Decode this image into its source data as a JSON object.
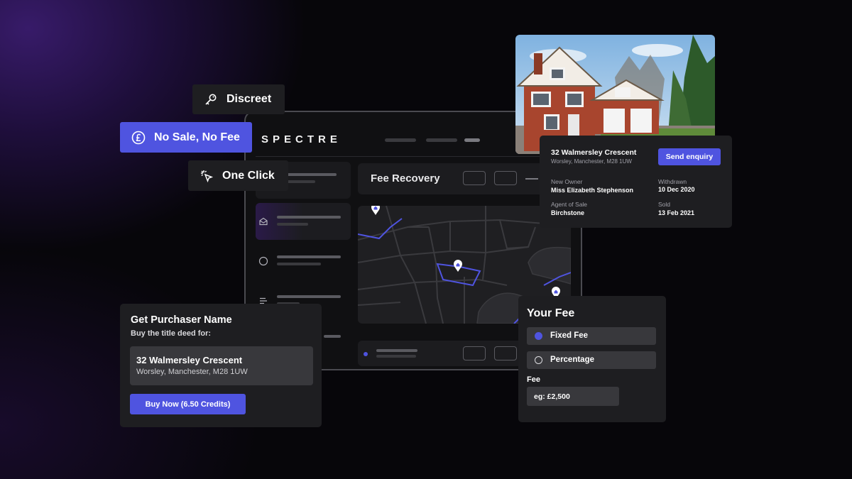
{
  "colors": {
    "accent": "#4f54e0",
    "card_bg": "#1e1e21",
    "field_bg": "#38383c",
    "background": "#07060a",
    "purple_glow": "#3a1c6e"
  },
  "pills": {
    "discreet": {
      "label": "Discreet",
      "icon": "key-icon"
    },
    "no_sale": {
      "label": "No Sale, No Fee",
      "icon": "pound-icon"
    },
    "one_click": {
      "label": "One Click",
      "icon": "cursor-click-icon"
    }
  },
  "app": {
    "logo": "SPECTRE",
    "section_title": "Fee Recovery",
    "sidebar_icons": [
      "mail-icon",
      "circle-icon",
      "list-icon"
    ],
    "map_pins": [
      "home-pin-icon",
      "home-pin-icon",
      "home-pin-icon"
    ]
  },
  "property": {
    "address": "32 Walmersley Crescent",
    "location": "Worsley, Manchester, M28 1UW",
    "send_enquiry_label": "Send enquiry",
    "new_owner_label": "New Owner",
    "new_owner_value": "Miss Elizabeth Stephenson",
    "withdrawn_label": "Withdrawn",
    "withdrawn_value": "10 Dec 2020",
    "agent_label": "Agent of Sale",
    "agent_value": "Birchstone",
    "sold_label": "Sold",
    "sold_value": "13 Feb 2021"
  },
  "purchaser": {
    "title": "Get Purchaser Name",
    "subtitle": "Buy the title deed for:",
    "address": "32 Walmersley Crescent",
    "location": "Worsley, Manchester, M28 1UW",
    "buy_label": "Buy Now (6.50 Credits)"
  },
  "fee": {
    "title": "Your Fee",
    "options": [
      {
        "label": "Fixed Fee",
        "selected": true
      },
      {
        "label": "Percentage",
        "selected": false
      }
    ],
    "field_label": "Fee",
    "placeholder": "eg: £2,500"
  }
}
